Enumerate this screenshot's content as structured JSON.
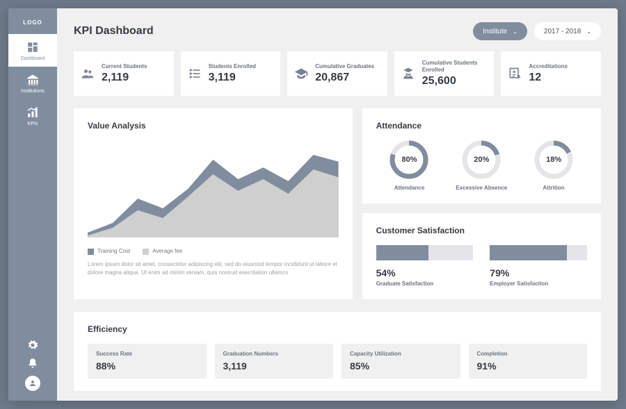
{
  "brand": {
    "logo": "LOGO"
  },
  "sidebar": {
    "items": [
      {
        "label": "Dashboard"
      },
      {
        "label": "Institutions"
      },
      {
        "label": "KPIs"
      }
    ]
  },
  "header": {
    "title": "KPI Dashboard",
    "institute_label": "Institute",
    "period_label": "2017 - 2018"
  },
  "stats": [
    {
      "label": "Current Students",
      "value": "2,119"
    },
    {
      "label": "Students Enrolled",
      "value": "3,119"
    },
    {
      "label": "Cumulative Graduates",
      "value": "20,867"
    },
    {
      "label": "Cumulative Students Enrolled",
      "value": "25,600"
    },
    {
      "label": "Accreditations",
      "value": "12"
    }
  ],
  "value_analysis": {
    "title": "Value Analysis",
    "legend": {
      "a": "Training Cost",
      "b": "Average fee"
    },
    "lorem": "Lorem ipsum dolor sit amet, consectetur adipiscing elit, sed do eiusmod tempor incididunt ut labore et dolore magna aliqua. Ut enim ad minim veniam, quis nostrud exercitation ullamco"
  },
  "attendance": {
    "title": "Attendance",
    "items": [
      {
        "value": 80,
        "display": "80%",
        "caption": "Attendance"
      },
      {
        "value": 20,
        "display": "20%",
        "caption": "Excessive Absence"
      },
      {
        "value": 18,
        "display": "18%",
        "caption": "Attrition"
      }
    ]
  },
  "satisfaction": {
    "title": "Customer Satisfaction",
    "items": [
      {
        "value": 54,
        "display": "54%",
        "caption": "Graduate Satisfaction"
      },
      {
        "value": 79,
        "display": "79%",
        "caption": "Employer Satisfaction"
      }
    ]
  },
  "efficiency": {
    "title": "Efficiency",
    "items": [
      {
        "label": "Success Rate",
        "value": "88%"
      },
      {
        "label": "Graduation Numbers",
        "value": "3,119"
      },
      {
        "label": "Capacity Utilization",
        "value": "85%"
      },
      {
        "label": "Completion",
        "value": "91%"
      }
    ]
  },
  "chart_data": {
    "type": "area",
    "x": [
      0,
      1,
      2,
      3,
      4,
      5,
      6,
      7,
      8,
      9,
      10
    ],
    "series": [
      {
        "name": "Training Cost",
        "color": "#808d9e",
        "values": [
          5,
          15,
          40,
          30,
          50,
          80,
          60,
          72,
          58,
          85,
          78
        ]
      },
      {
        "name": "Average fee",
        "color": "#cfcfcf",
        "values": [
          2,
          10,
          28,
          20,
          42,
          65,
          48,
          60,
          45,
          70,
          62
        ]
      }
    ],
    "xlabel": "",
    "ylabel": "",
    "ylim": [
      0,
      100
    ]
  },
  "colors": {
    "accent": "#808d9e",
    "muted": "#cfcfcf",
    "track": "#e3e5e9"
  }
}
